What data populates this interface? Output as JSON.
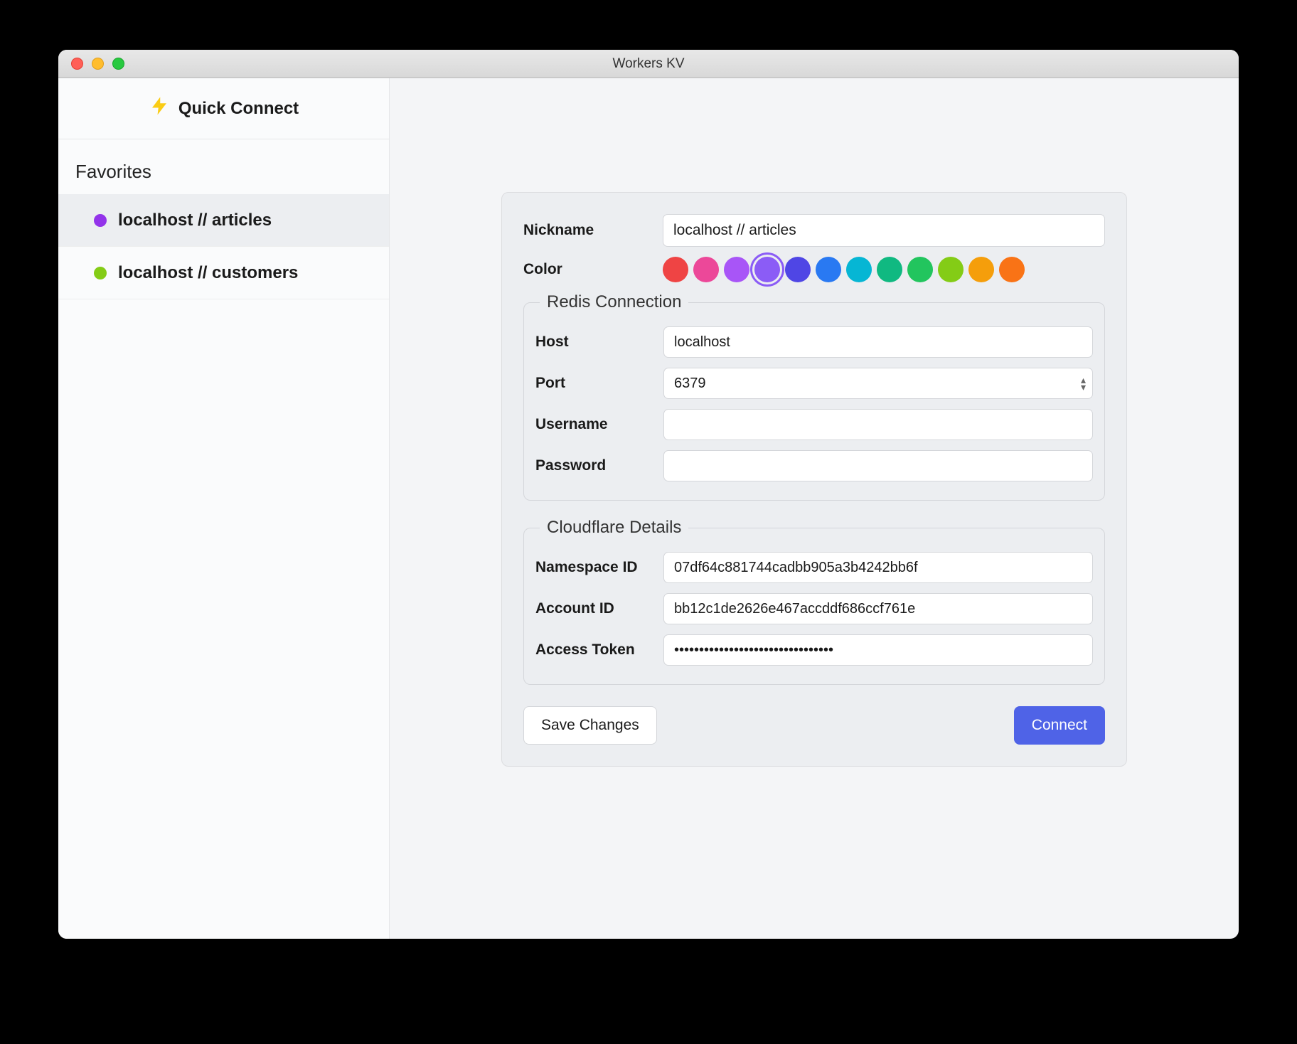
{
  "window": {
    "title": "Workers KV"
  },
  "sidebar": {
    "quick_connect_label": "Quick Connect",
    "favorites_header": "Favorites",
    "items": [
      {
        "label": "localhost // articles",
        "color": "#9333ea",
        "selected": true
      },
      {
        "label": "localhost // customers",
        "color": "#84cc16",
        "selected": false
      }
    ]
  },
  "form": {
    "nickname_label": "Nickname",
    "nickname_value": "localhost // articles",
    "color_label": "Color",
    "colors": [
      {
        "hex": "#ef4444",
        "selected": false
      },
      {
        "hex": "#ec4899",
        "selected": false
      },
      {
        "hex": "#a855f7",
        "selected": false
      },
      {
        "hex": "#8b5cf6",
        "selected": true
      },
      {
        "hex": "#4f46e5",
        "selected": false
      },
      {
        "hex": "#2979f2",
        "selected": false
      },
      {
        "hex": "#06b6d4",
        "selected": false
      },
      {
        "hex": "#10b981",
        "selected": false
      },
      {
        "hex": "#22c55e",
        "selected": false
      },
      {
        "hex": "#84cc16",
        "selected": false
      },
      {
        "hex": "#f59e0b",
        "selected": false
      },
      {
        "hex": "#f97316",
        "selected": false
      }
    ],
    "redis": {
      "legend": "Redis Connection",
      "host_label": "Host",
      "host_value": "localhost",
      "port_label": "Port",
      "port_value": "6379",
      "username_label": "Username",
      "username_value": "",
      "password_label": "Password",
      "password_value": ""
    },
    "cloudflare": {
      "legend": "Cloudflare Details",
      "namespace_label": "Namespace ID",
      "namespace_value": "07df64c881744cadbb905a3b4242bb6f",
      "account_label": "Account ID",
      "account_value": "bb12c1de2626e467accddf686ccf761e",
      "token_label": "Access Token",
      "token_value": "••••••••••••••••••••••••••••••••"
    },
    "save_label": "Save Changes",
    "connect_label": "Connect"
  }
}
